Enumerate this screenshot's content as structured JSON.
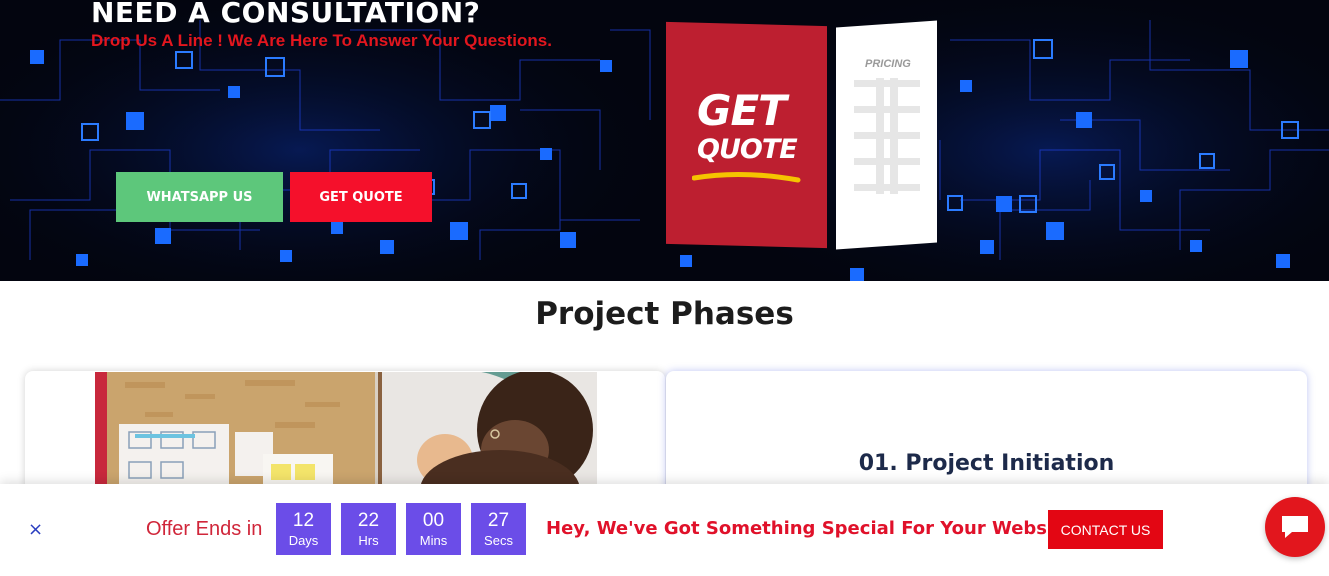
{
  "hero": {
    "title": "NEED A CONSULTATION?",
    "subtitle": "Drop Us A Line ! We Are Here To Answer Your Questions.",
    "whatsapp_label": "WHATSAPP US",
    "quote_label": "GET QUOTE",
    "graphic": {
      "get_text": "GET",
      "quote_text": "QUOTE",
      "pricing_text": "PRICING"
    }
  },
  "section": {
    "title": "Project Phases",
    "phase_title": "01. Project Initiation"
  },
  "offer_bar": {
    "offer_text": "Offer Ends in",
    "timer": [
      {
        "value": "12",
        "unit": "Days"
      },
      {
        "value": "22",
        "unit": "Hrs"
      },
      {
        "value": "00",
        "unit": "Mins"
      },
      {
        "value": "27",
        "unit": "Secs"
      }
    ],
    "special_text": "Hey, We've Got Something Special For Your Website",
    "contact_label": "CONTACT US",
    "close_glyph": "×"
  },
  "colors": {
    "accent_red": "#e30613",
    "timer_purple": "#6b4de8",
    "whatsapp_green": "#5dc77b",
    "quote_red": "#f5102b"
  },
  "icons": [
    "close-icon",
    "chat-icon",
    "circuit-background",
    "pricing-sheet-graphic"
  ]
}
